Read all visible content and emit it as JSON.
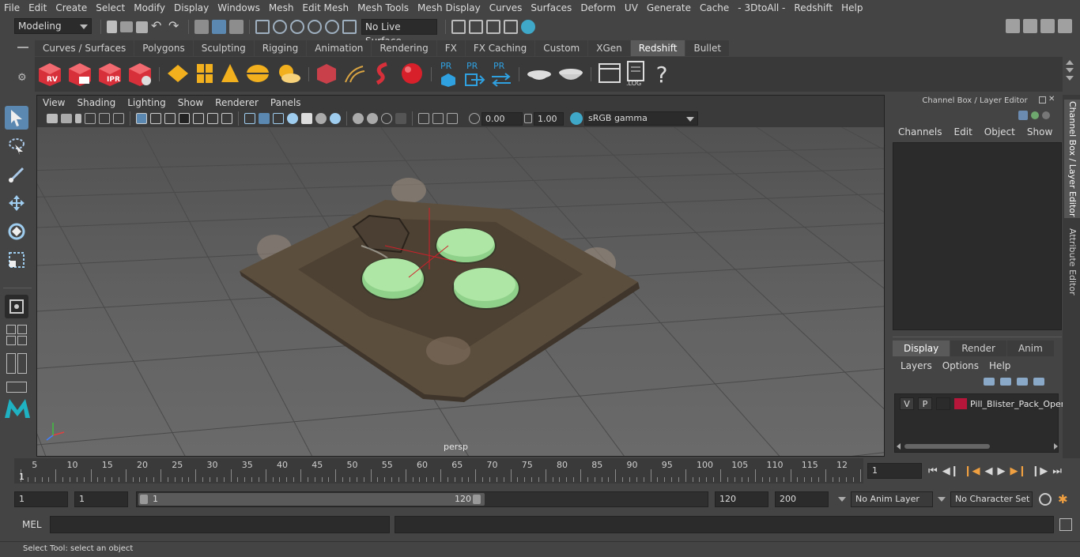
{
  "menubar": [
    "File",
    "Edit",
    "Create",
    "Select",
    "Modify",
    "Display",
    "Windows",
    "Mesh",
    "Edit Mesh",
    "Mesh Tools",
    "Mesh Display",
    "Curves",
    "Surfaces",
    "Deform",
    "UV",
    "Generate",
    "Cache",
    "- 3DtoAll -",
    "Redshift",
    "Help"
  ],
  "status": {
    "mode": "Modeling",
    "live_surface": "No Live Surface"
  },
  "shelf_tabs": [
    "Curves / Surfaces",
    "Polygons",
    "Sculpting",
    "Rigging",
    "Animation",
    "Rendering",
    "FX",
    "FX Caching",
    "Custom",
    "XGen",
    "Redshift",
    "Bullet"
  ],
  "shelf_active": "Redshift",
  "shelf_labels": {
    "rv": "RV",
    "ipr": "IPR",
    "pr": "PR",
    "log": ".LOG",
    "help": "?"
  },
  "viewport": {
    "menu": [
      "View",
      "Shading",
      "Lighting",
      "Show",
      "Renderer",
      "Panels"
    ],
    "exposure": "0.00",
    "gamma": "1.00",
    "colorspace": "sRGB gamma",
    "camera": "persp"
  },
  "channel_box": {
    "title": "Channel Box / Layer Editor",
    "menu": [
      "Channels",
      "Edit",
      "Object",
      "Show"
    ]
  },
  "layer_editor": {
    "tabs": [
      "Display",
      "Render",
      "Anim"
    ],
    "active_tab": "Display",
    "menu": [
      "Layers",
      "Options",
      "Help"
    ],
    "layer": {
      "v": "V",
      "p": "P",
      "name": "Pill_Blister_Pack_Open",
      "color": "#b5163a"
    }
  },
  "side_tabs": [
    "Channel Box / Layer Editor",
    "Attribute Editor"
  ],
  "timeline": {
    "ticks": [
      "5",
      "10",
      "15",
      "20",
      "25",
      "30",
      "35",
      "40",
      "45",
      "50",
      "55",
      "60",
      "65",
      "70",
      "75",
      "80",
      "85",
      "90",
      "95",
      "100",
      "105",
      "110",
      "115",
      "12"
    ],
    "current_marker": "1",
    "current_frame": "1"
  },
  "range": {
    "start": "1",
    "anim_start": "1",
    "range_start": "1",
    "range_end": "120",
    "end": "120",
    "anim_end": "200",
    "anim_layer": "No Anim Layer",
    "char_set": "No Character Set"
  },
  "mel": {
    "label": "MEL"
  },
  "help_line": "Select Tool: select an object"
}
